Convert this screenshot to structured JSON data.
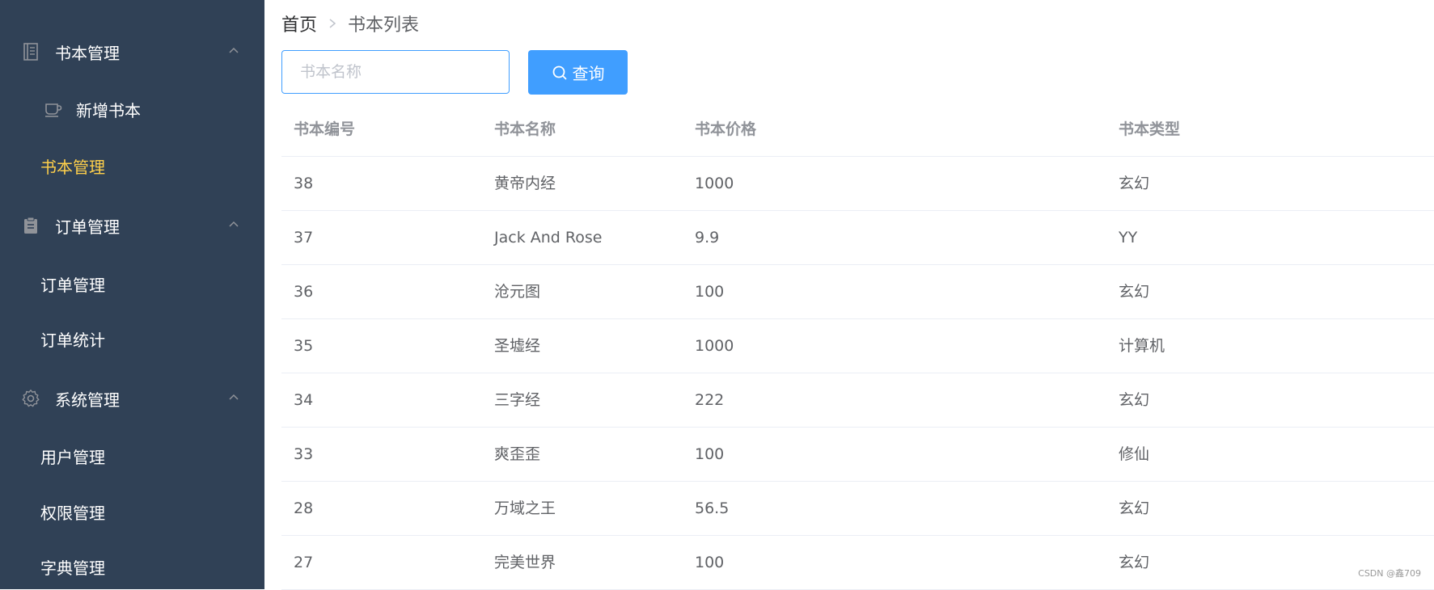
{
  "sidebar": {
    "groups": [
      {
        "label": "书本管理",
        "icon": "document-icon",
        "items": [
          {
            "label": "新增书本",
            "icon": "cup-icon"
          },
          {
            "label": "书本管理",
            "active": true
          }
        ]
      },
      {
        "label": "订单管理",
        "icon": "clipboard-icon",
        "items": [
          {
            "label": "订单管理"
          },
          {
            "label": "订单统计"
          }
        ]
      },
      {
        "label": "系统管理",
        "icon": "gear-icon",
        "items": [
          {
            "label": "用户管理"
          },
          {
            "label": "权限管理"
          },
          {
            "label": "字典管理"
          }
        ]
      }
    ],
    "colors": {
      "background": "#304156",
      "text": "#ffffff",
      "active": "#ffd04b"
    }
  },
  "breadcrumb": {
    "home": "首页",
    "current": "书本列表"
  },
  "search": {
    "placeholder": "书本名称",
    "value": "",
    "button_label": "查询"
  },
  "table": {
    "columns": [
      "书本编号",
      "书本名称",
      "书本价格",
      "书本类型"
    ],
    "rows": [
      [
        "38",
        "黄帝内经",
        "1000",
        "玄幻"
      ],
      [
        "37",
        "Jack And Rose",
        "9.9",
        "YY"
      ],
      [
        "36",
        "沧元图",
        "100",
        "玄幻"
      ],
      [
        "35",
        "圣墟经",
        "1000",
        "计算机"
      ],
      [
        "34",
        "三字经",
        "222",
        "玄幻"
      ],
      [
        "33",
        "爽歪歪",
        "100",
        "修仙"
      ],
      [
        "28",
        "万域之王",
        "56.5",
        "玄幻"
      ],
      [
        "27",
        "完美世界",
        "100",
        "玄幻"
      ]
    ]
  },
  "colors": {
    "primary": "#409eff",
    "header_text": "#909399",
    "cell_text": "#606266",
    "border": "#ebeef5"
  },
  "watermark": "CSDN @鑫709"
}
